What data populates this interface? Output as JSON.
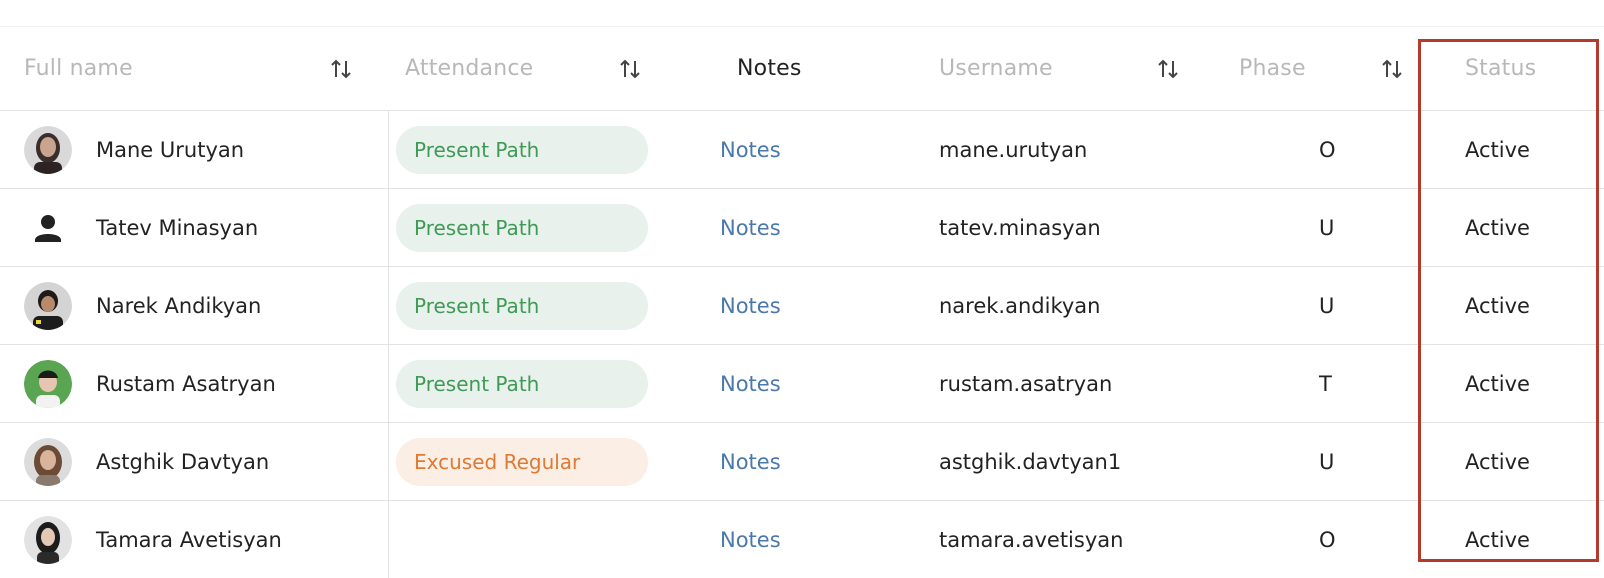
{
  "columns": {
    "full_name": "Full name",
    "attendance": "Attendance",
    "notes": "Notes",
    "username": "Username",
    "phase": "Phase",
    "status": "Status"
  },
  "colors": {
    "present_bg": "#e9f1ec",
    "present_text": "#3f9a55",
    "excused_bg": "#fbeee5",
    "excused_text": "#dd7a33",
    "link": "#4a78aa",
    "highlight": "#b43a2c"
  },
  "rows": [
    {
      "name": "Mane Urutyan",
      "avatar": "photo",
      "attendance": "Present Path",
      "attendance_type": "present",
      "notes": "Notes",
      "username": "mane.urutyan",
      "phase": "O",
      "status": "Active"
    },
    {
      "name": "Tatev Minasyan",
      "avatar": "person-icon",
      "attendance": "Present Path",
      "attendance_type": "present",
      "notes": "Notes",
      "username": "tatev.minasyan",
      "phase": "U",
      "status": "Active"
    },
    {
      "name": "Narek Andikyan",
      "avatar": "photo",
      "attendance": "Present Path",
      "attendance_type": "present",
      "notes": "Notes",
      "username": "narek.andikyan",
      "phase": "U",
      "status": "Active"
    },
    {
      "name": "Rustam Asatryan",
      "avatar": "photo",
      "attendance": "Present Path",
      "attendance_type": "present",
      "notes": "Notes",
      "username": "rustam.asatryan",
      "phase": "T",
      "status": "Active"
    },
    {
      "name": "Astghik Davtyan",
      "avatar": "photo",
      "attendance": "Excused Regular",
      "attendance_type": "excused",
      "notes": "Notes",
      "username": "astghik.davtyan1",
      "phase": "U",
      "status": "Active"
    },
    {
      "name": "Tamara Avetisyan",
      "avatar": "photo",
      "attendance": "",
      "attendance_type": "none",
      "notes": "Notes",
      "username": "tamara.avetisyan",
      "phase": "O",
      "status": "Active"
    }
  ]
}
